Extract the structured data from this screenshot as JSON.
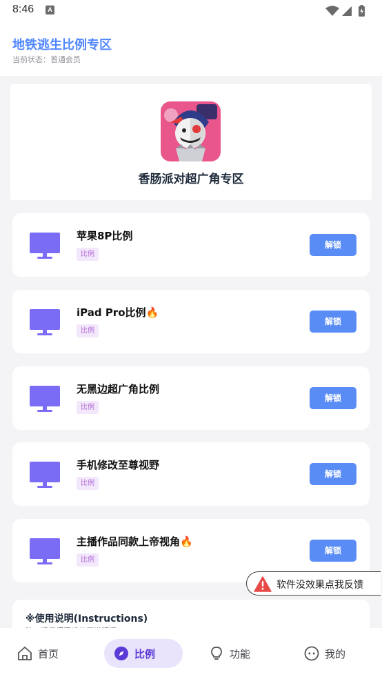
{
  "status_bar": {
    "time": "8:46",
    "notification_icon": "A"
  },
  "header": {
    "title": "地铁逃生比例专区",
    "status": "当前状态：普通会员"
  },
  "hero": {
    "title": "香肠派对超广角专区",
    "image_icon": "game-character-avatar"
  },
  "items": [
    {
      "title": "苹果8P比例",
      "tag": "比例",
      "button": "解锁",
      "hot": ""
    },
    {
      "title": "iPad Pro比例",
      "tag": "比例",
      "button": "解锁",
      "hot": "🔥"
    },
    {
      "title": "无黑边超广角比例",
      "tag": "比例",
      "button": "解锁",
      "hot": ""
    },
    {
      "title": "手机修改至尊视野",
      "tag": "比例",
      "button": "解锁",
      "hot": ""
    },
    {
      "title": "主播作品同款上帝视角",
      "tag": "比例",
      "button": "解锁",
      "hot": "🔥"
    }
  ],
  "feedback": {
    "label": "软件没效果点我反馈"
  },
  "instructions": {
    "title": "※使用说明(Instructions)",
    "subtitle": "注：请仔细阅读使用说明哦"
  },
  "nav": [
    {
      "label": "首页",
      "icon": "home-icon"
    },
    {
      "label": "比例",
      "icon": "compass-icon"
    },
    {
      "label": "功能",
      "icon": "lightbulb-icon"
    },
    {
      "label": "我的",
      "icon": "face-icon"
    }
  ],
  "colors": {
    "accent": "#5a8cf6",
    "title_blue": "#4f86ff",
    "monitor": "#7b6cf6",
    "tag_bg": "#f3e7fb",
    "nav_active": "#e9e3fb"
  }
}
